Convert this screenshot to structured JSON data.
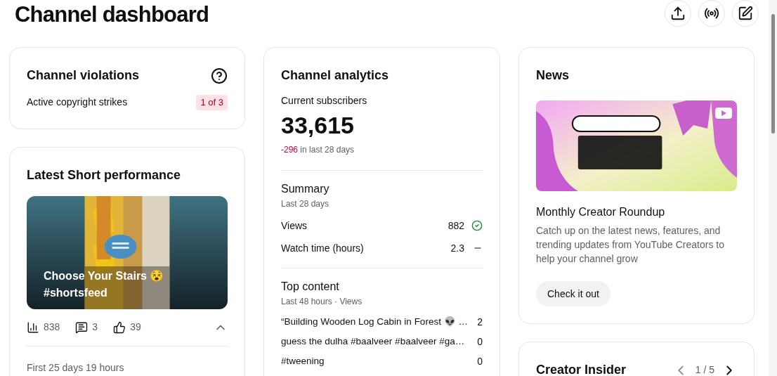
{
  "title": "Channel dashboard",
  "header_actions": [
    {
      "kind": "upload"
    },
    {
      "kind": "live"
    },
    {
      "kind": "edit"
    }
  ],
  "violations": {
    "title": "Channel violations",
    "label": "Active copyright strikes",
    "badge": "1 of 3"
  },
  "short": {
    "title": "Latest Short performance",
    "video_title": "Choose Your Stairs 😵 #shortsfeed",
    "stats": [
      {
        "kind": "views",
        "value": "838"
      },
      {
        "kind": "comments",
        "value": "3"
      },
      {
        "kind": "likes",
        "value": "39"
      }
    ],
    "expanded": true,
    "footer": "First 25 days 19 hours"
  },
  "analytics": {
    "title": "Channel analytics",
    "subscribers_label": "Current subscribers",
    "subscribers": "33,615",
    "change": "-296",
    "change_suffix": " in last 28 days",
    "summary": {
      "title": "Summary",
      "subtitle": "Last 28 days",
      "rows": [
        {
          "label": "Views",
          "value": "882",
          "kind": "check"
        },
        {
          "label": "Watch time (hours)",
          "value": "2.3",
          "kind": "flat"
        }
      ]
    },
    "top": {
      "title": "Top content",
      "subtitle": "Last 48 hours · Views",
      "rows": [
        {
          "label": "“Building Wooden Log Cabin in Forest 👽 …",
          "value": "2"
        },
        {
          "label": "guess the dulha #baalveer #baalveer #ga…",
          "value": "0"
        },
        {
          "label": "#tweening",
          "value": "0"
        }
      ]
    }
  },
  "news": {
    "title": "News",
    "headline": "Monthly Creator Roundup",
    "body": "Catch up on the latest news, features, and trending updates from YouTube Creators to help your channel grow",
    "button": "Check it out"
  },
  "insider": {
    "title": "Creator Insider",
    "pager": "1 / 5",
    "prev_disabled": true,
    "next_disabled": false
  }
}
